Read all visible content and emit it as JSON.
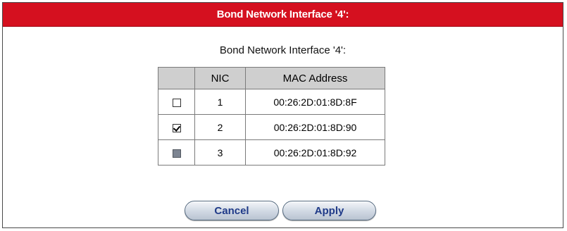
{
  "dialog": {
    "title": "Bond Network Interface '4':",
    "subtitle": "Bond Network Interface '4':"
  },
  "table": {
    "headers": [
      "",
      "NIC",
      "MAC Address"
    ],
    "rows": [
      {
        "checked": false,
        "disabled": false,
        "nic": "1",
        "mac": "00:26:2D:01:8D:8F"
      },
      {
        "checked": true,
        "disabled": false,
        "nic": "2",
        "mac": "00:26:2D:01:8D:90"
      },
      {
        "checked": false,
        "disabled": true,
        "nic": "3",
        "mac": "00:26:2D:01:8D:92"
      }
    ]
  },
  "buttons": {
    "cancel_label": "Cancel",
    "apply_label": "Apply"
  },
  "colors": {
    "titlebar": "#d5101f",
    "header_row": "#cfcfcf",
    "button_text": "#1f3a88"
  }
}
